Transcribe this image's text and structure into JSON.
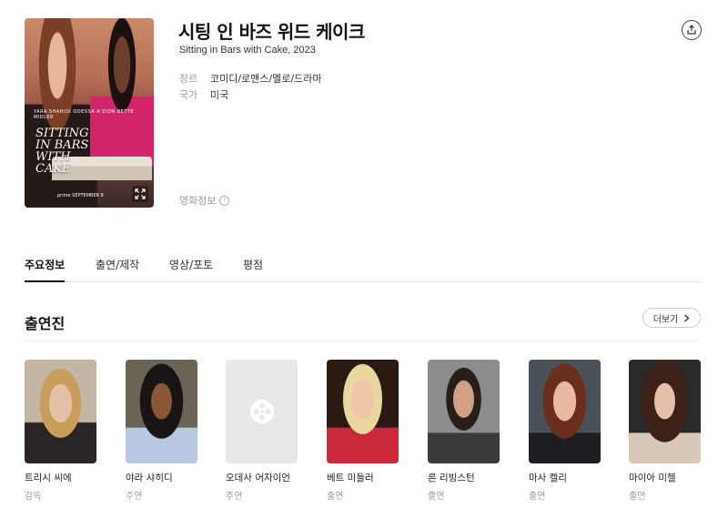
{
  "movie": {
    "title": "시팅 인 바즈 위드 케이크",
    "subtitle": "Sitting in Bars with Cake, 2023",
    "genre_label": "장르",
    "genre_value": "코미디/로맨스/멜로/드라마",
    "country_label": "국가",
    "country_value": "미국",
    "info_link": "영화정보",
    "info_icon": "!"
  },
  "poster": {
    "title_text": "SITTING IN BARS WITH CAKE",
    "credits": "YARA SHAHIDI  ODESSA A'ZION  BETTE MIDLER",
    "bottom_text": "prime  SEPTEMBER 8"
  },
  "tabs": [
    {
      "label": "주요정보",
      "active": true
    },
    {
      "label": "출연/제작",
      "active": false
    },
    {
      "label": "영상/포토",
      "active": false
    },
    {
      "label": "평점",
      "active": false
    }
  ],
  "cast_section": {
    "title": "출연진",
    "more_label": "더보기"
  },
  "cast": [
    {
      "name": "트리시 씨에",
      "role": "감독"
    },
    {
      "name": "야라 샤히디",
      "role": "주연"
    },
    {
      "name": "오데사 어자이언",
      "role": "주연"
    },
    {
      "name": "베트 미들러",
      "role": "출연"
    },
    {
      "name": "론 리빙스턴",
      "role": "출연"
    },
    {
      "name": "마사 켈리",
      "role": "출연"
    },
    {
      "name": "마이아 미첼",
      "role": "출연"
    }
  ],
  "icons": {
    "share": "share-icon",
    "expand": "expand-icon",
    "chevron": "chevron-right-icon",
    "placeholder": "film-reel-icon"
  }
}
